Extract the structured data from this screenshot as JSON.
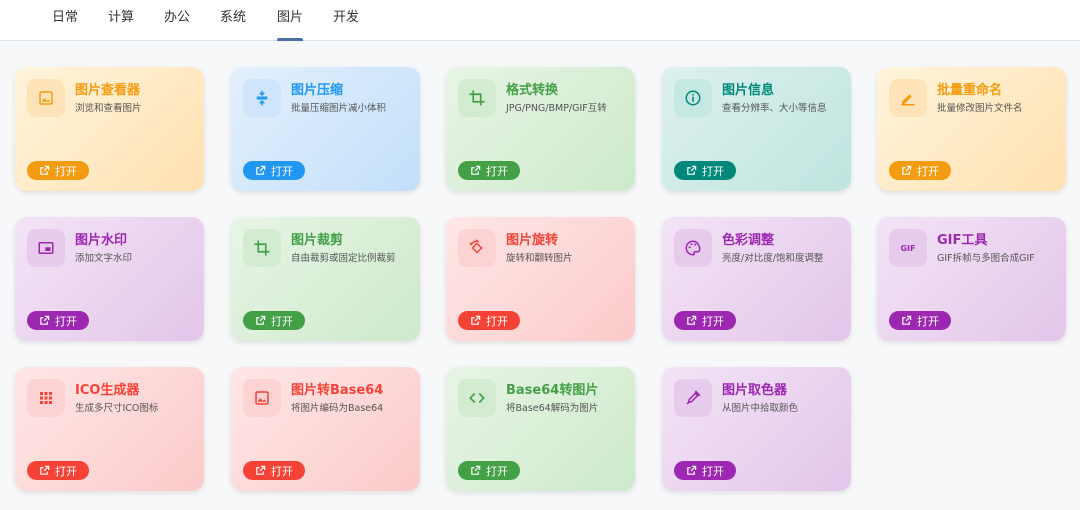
{
  "tabs": [
    {
      "label": "日常"
    },
    {
      "label": "计算"
    },
    {
      "label": "办公"
    },
    {
      "label": "系统"
    },
    {
      "label": "图片",
      "active": true
    },
    {
      "label": "开发"
    }
  ],
  "open_label": "打开",
  "cards": [
    {
      "title": "图片查看器",
      "desc": "浏览和查看图片",
      "icon": "image-icon",
      "theme": "orange"
    },
    {
      "title": "图片压缩",
      "desc": "批量压缩图片减小体积",
      "icon": "compress-icon",
      "theme": "blue"
    },
    {
      "title": "格式转换",
      "desc": "JPG/PNG/BMP/GIF互转",
      "icon": "crop-icon",
      "theme": "green"
    },
    {
      "title": "图片信息",
      "desc": "查看分辨率、大小等信息",
      "icon": "info-icon",
      "theme": "teal"
    },
    {
      "title": "批量重命名",
      "desc": "批量修改图片文件名",
      "icon": "pencil-icon",
      "theme": "orange"
    },
    {
      "title": "图片水印",
      "desc": "添加文字水印",
      "icon": "watermark-icon",
      "theme": "purple"
    },
    {
      "title": "图片裁剪",
      "desc": "自由裁剪或固定比例裁剪",
      "icon": "crop-icon",
      "theme": "green"
    },
    {
      "title": "图片旋转",
      "desc": "旋转和翻转图片",
      "icon": "rotate-icon",
      "theme": "red"
    },
    {
      "title": "色彩调整",
      "desc": "亮度/对比度/饱和度调整",
      "icon": "palette-icon",
      "theme": "purple"
    },
    {
      "title": "GIF工具",
      "desc": "GIF拆帧与多图合成GIF",
      "icon": "gif-icon",
      "theme": "purple",
      "icon_text": "GIF"
    },
    {
      "title": "ICO生成器",
      "desc": "生成多尺寸ICO图标",
      "icon": "grid-dots-icon",
      "theme": "red"
    },
    {
      "title": "图片转Base64",
      "desc": "将图片编码为Base64",
      "icon": "image-icon",
      "theme": "red"
    },
    {
      "title": "Base64转图片",
      "desc": "将Base64解码为图片",
      "icon": "code-icon",
      "theme": "green"
    },
    {
      "title": "图片取色器",
      "desc": "从图片中拾取颜色",
      "icon": "eyedropper-icon",
      "theme": "purple"
    }
  ],
  "themes": {
    "orange": {
      "accent": "#f39c12",
      "bg1": "#fff4dc",
      "bg2": "#ffe1b0",
      "iconbg": "#ffe3b8"
    },
    "blue": {
      "accent": "#2196f3",
      "bg1": "#e3f0fd",
      "bg2": "#c2dffa",
      "iconbg": "#cfe5fb"
    },
    "green": {
      "accent": "#43a047",
      "bg1": "#e8f5e6",
      "bg2": "#cde9cb",
      "iconbg": "#d3ecd1"
    },
    "teal": {
      "accent": "#00897b",
      "bg1": "#ddf1ee",
      "bg2": "#bfe4df",
      "iconbg": "#c6e8e3"
    },
    "purple": {
      "accent": "#9c27b0",
      "bg1": "#f3e4f6",
      "bg2": "#e3c6ea",
      "iconbg": "#e6cbec"
    },
    "red": {
      "accent": "#f44336",
      "bg1": "#ffe7e7",
      "bg2": "#fccaca",
      "iconbg": "#fcd2d2"
    }
  }
}
